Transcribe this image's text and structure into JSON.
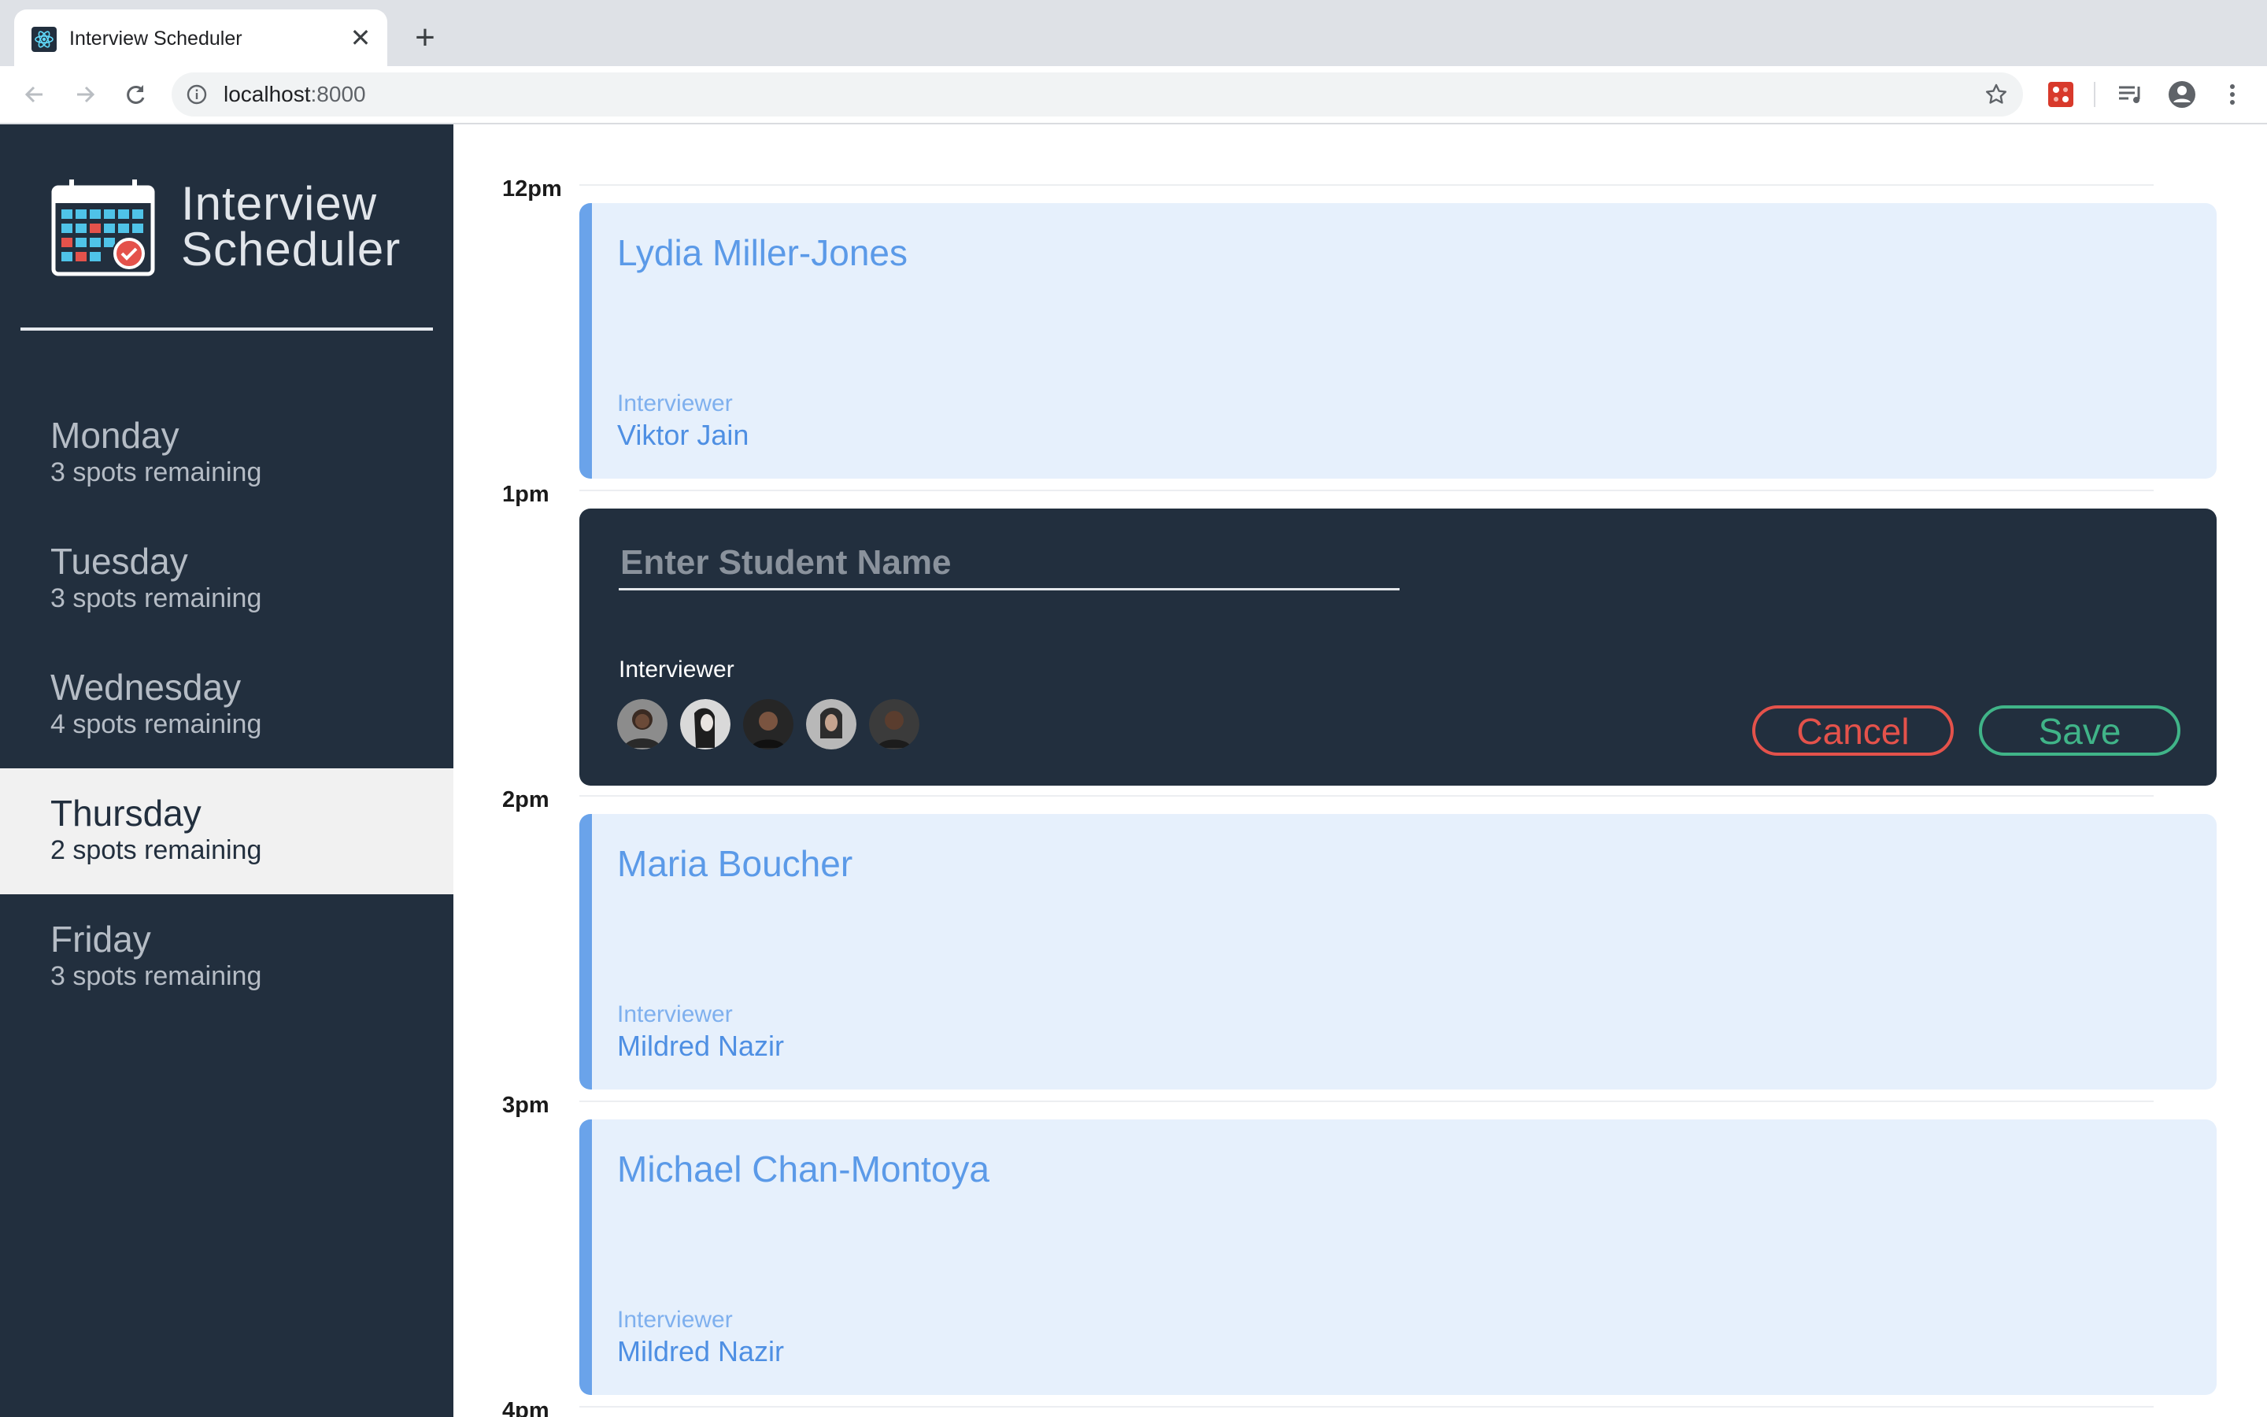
{
  "browser": {
    "tab_title": "Interview Scheduler",
    "new_tab_symbol": "+",
    "close_symbol": "✕",
    "url_host": "localhost",
    "url_port": ":8000"
  },
  "app": {
    "logo_line1": "Interview",
    "logo_line2": "Scheduler"
  },
  "days": [
    {
      "name": "Monday",
      "spots": "3 spots remaining",
      "selected": false
    },
    {
      "name": "Tuesday",
      "spots": "3 spots remaining",
      "selected": false
    },
    {
      "name": "Wednesday",
      "spots": "4 spots remaining",
      "selected": false
    },
    {
      "name": "Thursday",
      "spots": "2 spots remaining",
      "selected": true
    },
    {
      "name": "Friday",
      "spots": "3 spots remaining",
      "selected": false
    }
  ],
  "schedule": {
    "hours": [
      "12pm",
      "1pm",
      "2pm",
      "3pm",
      "4pm"
    ],
    "appointments": [
      {
        "student": "Lydia Miller-Jones",
        "interviewer_label": "Interviewer",
        "interviewer": "Viktor Jain"
      },
      {
        "student": "Maria Boucher",
        "interviewer_label": "Interviewer",
        "interviewer": "Mildred Nazir"
      },
      {
        "student": "Michael Chan-Montoya",
        "interviewer_label": "Interviewer",
        "interviewer": "Mildred Nazir"
      }
    ],
    "form": {
      "student_placeholder": "Enter Student Name",
      "student_value": "",
      "interviewer_label": "Interviewer",
      "avatar_count": 5,
      "cancel_label": "Cancel",
      "save_label": "Save"
    }
  },
  "colors": {
    "sidebar": "#222f3e",
    "appointment_bg": "#e6f0fc",
    "appointment_accent": "#6aa3ea",
    "cancel": "#e4524b",
    "save": "#40b488"
  }
}
